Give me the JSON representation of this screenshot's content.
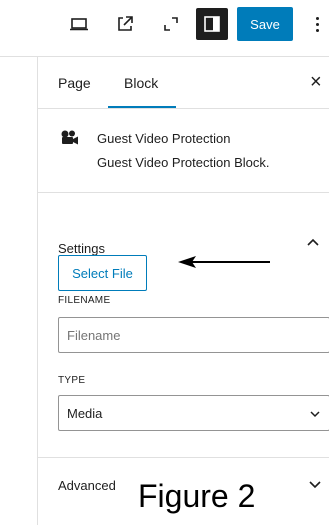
{
  "toolbar": {
    "icons": [
      "desktop-preview-icon",
      "external-link-icon",
      "fullscreen-icon",
      "sidebar-toggle-icon"
    ],
    "save_label": "Save",
    "accent_color": "#007cba"
  },
  "sidebar": {
    "tabs": [
      {
        "label": "Page"
      },
      {
        "label": "Block"
      }
    ],
    "active_tab": "Block",
    "close_icon": "×",
    "block": {
      "title": "Guest Video Protection",
      "description": "Guest Video Protection Block."
    },
    "settings": {
      "heading": "Settings",
      "select_file_label": "Select File",
      "filename_label": "FILENAME",
      "filename_placeholder": "Filename",
      "filename_value": "",
      "type_label": "TYPE",
      "type_value": "Media"
    },
    "advanced": {
      "heading": "Advanced"
    }
  },
  "caption": "Figure 2"
}
